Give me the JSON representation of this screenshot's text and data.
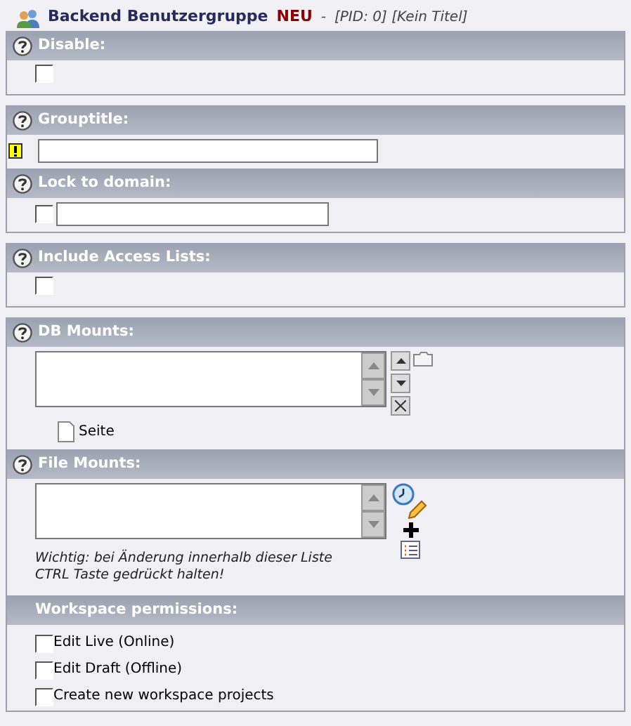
{
  "header": {
    "title": "Backend Benutzergruppe",
    "status": "NEU",
    "separator": "-",
    "meta": "[PID: 0] [Kein Titel]"
  },
  "groups": [
    {
      "fields": [
        {
          "kind": "checkbox",
          "label": "Disable:",
          "help": true,
          "checked": false
        }
      ]
    },
    {
      "fields": [
        {
          "kind": "text",
          "label": "Grouptitle:",
          "help": true,
          "required": true
        },
        {
          "kind": "checkbox_text",
          "label": "Lock to domain:",
          "help": true,
          "checked": false
        }
      ]
    },
    {
      "fields": [
        {
          "kind": "checkbox",
          "label": "Include Access Lists:",
          "help": true,
          "checked": false
        }
      ]
    },
    {
      "fields": [
        {
          "kind": "dbmounts",
          "label": "DB Mounts:",
          "help": true,
          "link": "Seite"
        },
        {
          "kind": "filemounts",
          "label": "File Mounts:",
          "help": true,
          "note": "Wichtig: bei Änderung innerhalb dieser Liste CTRL Taste gedrückt halten!"
        },
        {
          "kind": "checklist",
          "label": "Workspace permissions:",
          "help": false,
          "items": [
            {
              "label": "Edit Live (Online)",
              "checked": false
            },
            {
              "label": "Edit Draft (Offline)",
              "checked": false
            },
            {
              "label": "Create new workspace projects",
              "checked": false
            }
          ]
        }
      ]
    }
  ]
}
